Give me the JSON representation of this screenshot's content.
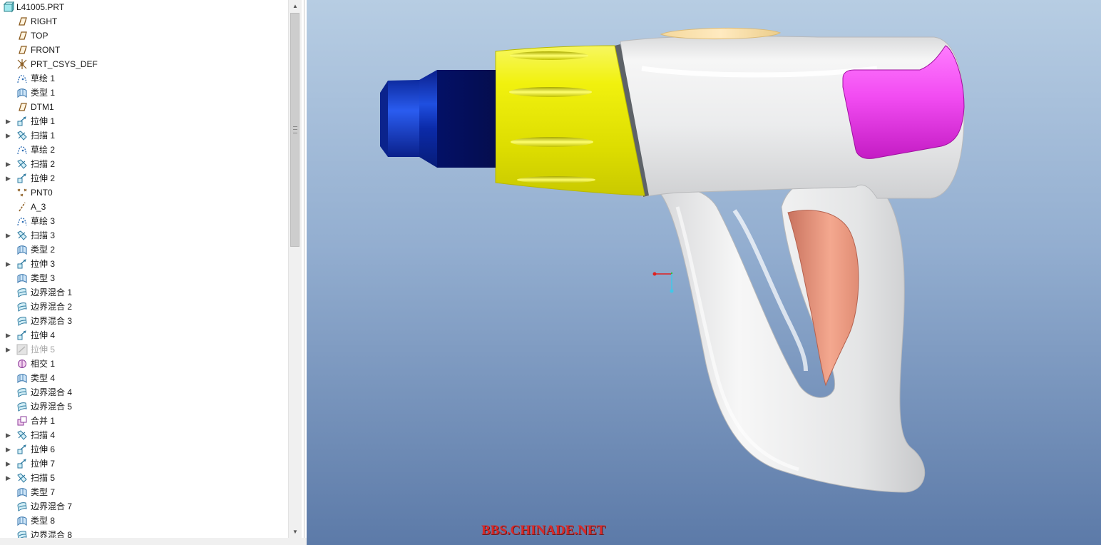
{
  "model_tree": {
    "items": [
      {
        "label": "L41005.PRT",
        "icon": "part-icon",
        "expandable": false,
        "root": true
      },
      {
        "label": "RIGHT",
        "icon": "datum-plane-icon",
        "expandable": false
      },
      {
        "label": "TOP",
        "icon": "datum-plane-icon",
        "expandable": false
      },
      {
        "label": "FRONT",
        "icon": "datum-plane-icon",
        "expandable": false
      },
      {
        "label": "PRT_CSYS_DEF",
        "icon": "csys-icon",
        "expandable": false
      },
      {
        "label": "草绘 1",
        "icon": "sketch-icon",
        "expandable": false
      },
      {
        "label": "类型 1",
        "icon": "style-surface-icon",
        "expandable": false
      },
      {
        "label": "DTM1",
        "icon": "datum-plane-icon",
        "expandable": false
      },
      {
        "label": "拉伸 1",
        "icon": "extrude-icon",
        "expandable": true
      },
      {
        "label": "扫描 1",
        "icon": "sweep-icon",
        "expandable": true
      },
      {
        "label": "草绘 2",
        "icon": "sketch-icon",
        "expandable": false
      },
      {
        "label": "扫描 2",
        "icon": "sweep-icon",
        "expandable": true
      },
      {
        "label": "拉伸 2",
        "icon": "extrude-icon",
        "expandable": true
      },
      {
        "label": "PNT0",
        "icon": "datum-point-icon",
        "expandable": false
      },
      {
        "label": "A_3",
        "icon": "datum-axis-icon",
        "expandable": false
      },
      {
        "label": "草绘 3",
        "icon": "sketch-icon",
        "expandable": false
      },
      {
        "label": "扫描 3",
        "icon": "sweep-icon",
        "expandable": true
      },
      {
        "label": "类型 2",
        "icon": "style-surface-icon",
        "expandable": false
      },
      {
        "label": "拉伸 3",
        "icon": "extrude-icon",
        "expandable": true
      },
      {
        "label": "类型 3",
        "icon": "style-surface-icon",
        "expandable": false
      },
      {
        "label": "边界混合 1",
        "icon": "boundary-blend-icon",
        "expandable": false
      },
      {
        "label": "边界混合 2",
        "icon": "boundary-blend-icon",
        "expandable": false
      },
      {
        "label": "边界混合 3",
        "icon": "boundary-blend-icon",
        "expandable": false
      },
      {
        "label": "拉伸 4",
        "icon": "extrude-icon",
        "expandable": true
      },
      {
        "label": "拉伸 5",
        "icon": "extrude-suppressed-icon",
        "expandable": true,
        "suppressed": true
      },
      {
        "label": "相交 1",
        "icon": "intersect-icon",
        "expandable": false
      },
      {
        "label": "类型 4",
        "icon": "style-surface-icon",
        "expandable": false
      },
      {
        "label": "边界混合 4",
        "icon": "boundary-blend-icon",
        "expandable": false
      },
      {
        "label": "边界混合 5",
        "icon": "boundary-blend-icon",
        "expandable": false
      },
      {
        "label": "合并 1",
        "icon": "merge-icon",
        "expandable": false
      },
      {
        "label": "扫描 4",
        "icon": "sweep-icon",
        "expandable": true
      },
      {
        "label": "拉伸 6",
        "icon": "extrude-icon",
        "expandable": true
      },
      {
        "label": "拉伸 7",
        "icon": "extrude-icon",
        "expandable": true
      },
      {
        "label": "扫描 5",
        "icon": "sweep-icon",
        "expandable": true
      },
      {
        "label": "类型 7",
        "icon": "style-surface-icon",
        "expandable": false
      },
      {
        "label": "边界混合 7",
        "icon": "boundary-blend-icon",
        "expandable": false
      },
      {
        "label": "类型 8",
        "icon": "style-surface-icon",
        "expandable": false
      },
      {
        "label": "边界混合 8",
        "icon": "boundary-blend-icon",
        "expandable": false
      }
    ]
  },
  "viewport": {
    "watermark": "BBS.CHINADE.NET",
    "colors": {
      "nozzle": "#0a2a9e",
      "collar": "#e6e600",
      "body": "#e8e9ea",
      "top_pad": "#f1d9a0",
      "rear_cap": "#ee33ee",
      "grip_pad": "#e99a86"
    }
  }
}
